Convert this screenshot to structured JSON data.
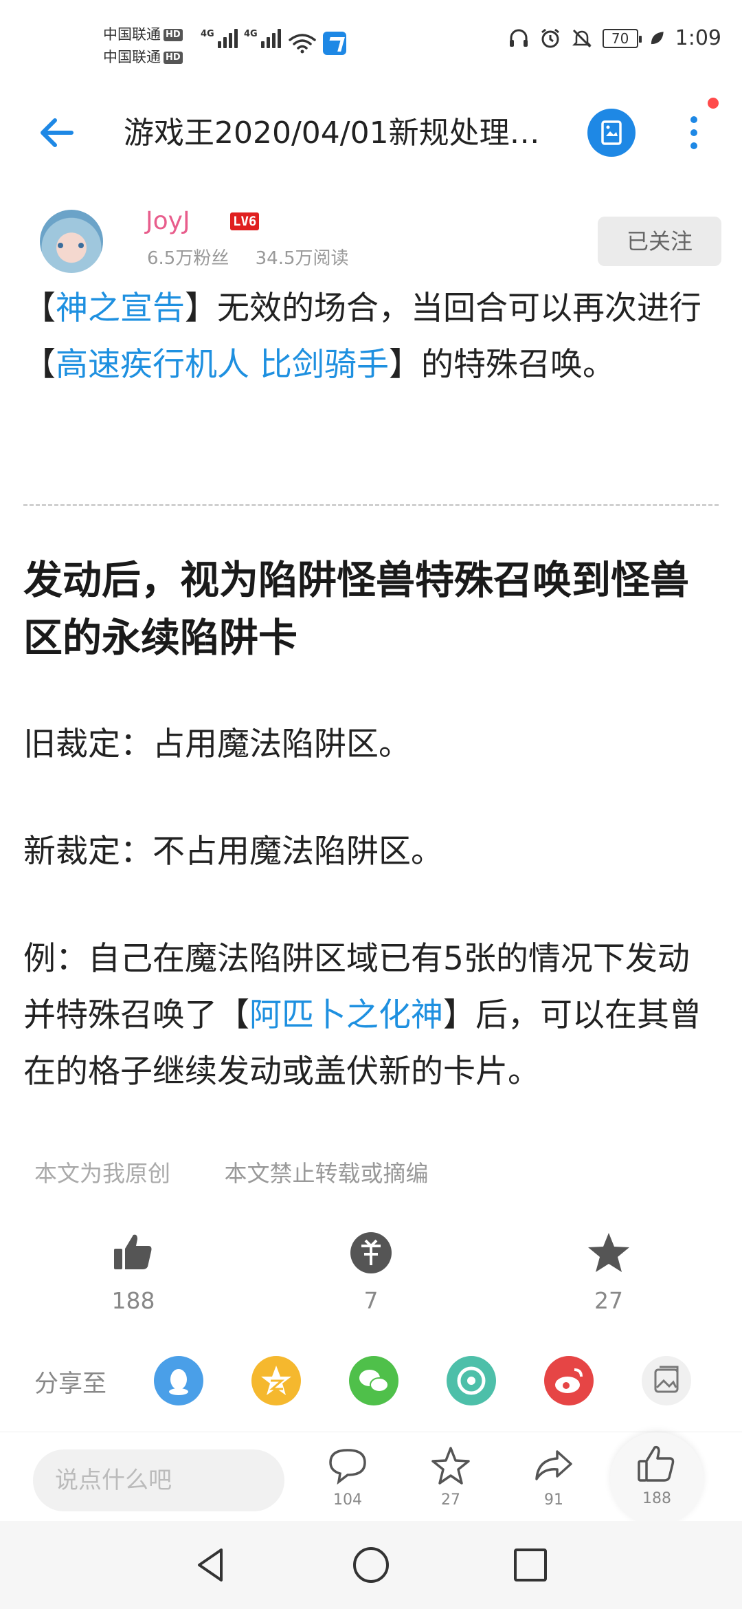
{
  "status_bar": {
    "carrier_1": "中国联通",
    "carrier_2": "中国联通",
    "hd_label": "HD",
    "network_label": "4G",
    "battery_level": "70",
    "time": "1:09",
    "icons": [
      "signal-icon",
      "wifi-icon",
      "app-notification-icon",
      "headset-icon",
      "alarm-icon",
      "mute-icon",
      "battery-icon",
      "leaf-icon"
    ]
  },
  "header": {
    "title": "游戏王2020/04/01新规处理…"
  },
  "author": {
    "name": "JoyJ",
    "level": "LV6",
    "fans": "6.5万粉丝",
    "reads": "34.5万阅读",
    "follow_label": "已关注"
  },
  "article": {
    "p1": {
      "b1": "【",
      "link1": "神之宣告",
      "t1": "】无效的场合，当回合可以再次进行【",
      "link2": "高速疾行机人 比剑骑手",
      "t2": "】的特殊召唤。"
    },
    "heading": "发动后，视为陷阱怪兽特殊召唤到怪兽区的永续陷阱卡",
    "old_ruling": "旧裁定：占用魔法陷阱区。",
    "new_ruling": "新裁定：不占用魔法陷阱区。",
    "example": {
      "t1": "例：自己在魔法陷阱区域已有5张的情况下发动并特殊召唤了【",
      "link": "阿匹卜之化神",
      "t2": "】后，可以在其曾在的格子继续发动或盖伏新的卡片。"
    }
  },
  "notes": {
    "original": "本文为我原创",
    "no_repost": "本文禁止转载或摘编"
  },
  "reactions": {
    "like_count": "188",
    "coin_count": "7",
    "favorite_count": "27"
  },
  "share": {
    "label": "分享至",
    "targets": [
      "qq-icon",
      "qzone-icon",
      "wechat-icon",
      "moments-icon",
      "weibo-icon",
      "share-image-icon"
    ]
  },
  "bottom_bar": {
    "comment_placeholder": "说点什么吧",
    "comment_count": "104",
    "favorite_count": "27",
    "share_count": "91",
    "like_count": "188"
  },
  "colors": {
    "accent": "#1e88e5",
    "link": "#1e90e0",
    "author_name": "#e85d8c",
    "level_badge": "#e02020"
  }
}
